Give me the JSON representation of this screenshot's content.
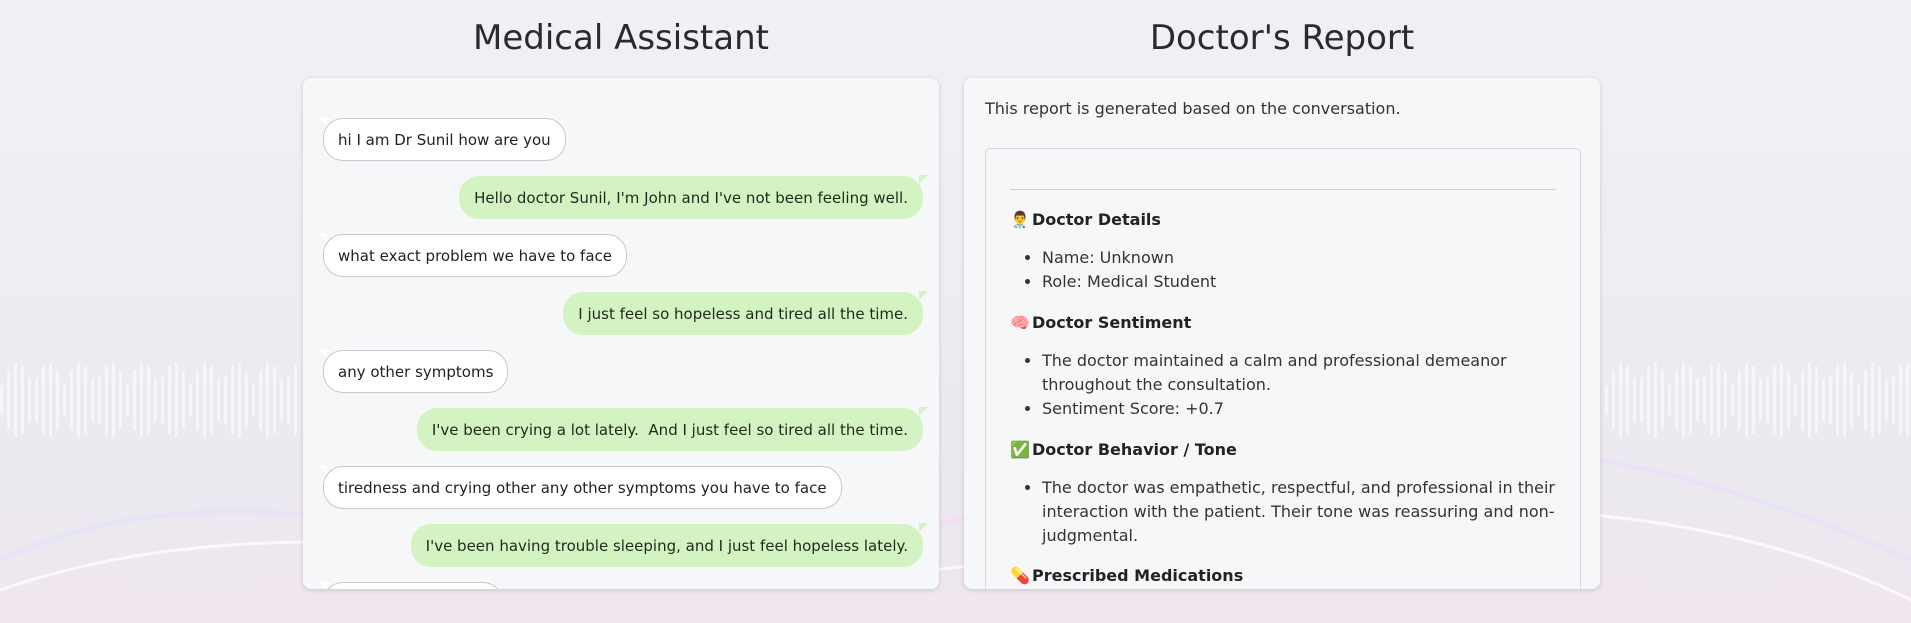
{
  "chat_title": "Medical Assistant",
  "report_title": "Doctor's Report",
  "messages": [
    {
      "role": "doctor",
      "text": "hi I am Dr Sunil how are you"
    },
    {
      "role": "patient",
      "text": "Hello doctor Sunil, I'm John and I've not been feeling well."
    },
    {
      "role": "doctor",
      "text": "what exact problem we have to face"
    },
    {
      "role": "patient",
      "text": "I just feel so hopeless and tired all the time."
    },
    {
      "role": "doctor",
      "text": "any other symptoms"
    },
    {
      "role": "patient",
      "text": "I've been crying a lot lately.  And I just feel so tired all the time."
    },
    {
      "role": "doctor",
      "text": "tiredness and crying other any other symptoms you have to face"
    },
    {
      "role": "patient",
      "text": "I've been having trouble sleeping, and I just feel hopeless lately."
    },
    {
      "role": "doctor",
      "text": ""
    }
  ],
  "report": {
    "intro": "This report is generated based on the conversation.",
    "sections": [
      {
        "icon": "doctor-icon",
        "emoji": "👨‍⚕️",
        "title": "Doctor Details",
        "items": [
          "Name: Unknown",
          "Role: Medical Student"
        ]
      },
      {
        "icon": "brain-icon",
        "emoji": "🧠",
        "title": "Doctor Sentiment",
        "items": [
          "The doctor maintained a calm and professional demeanor throughout the consultation.",
          "Sentiment Score: +0.7"
        ]
      },
      {
        "icon": "check-mark-icon",
        "emoji": "✅",
        "title": "Doctor Behavior / Tone",
        "items": [
          "The doctor was empathetic, respectful, and professional in their interaction with the patient. Their tone was reassuring and non-judgmental."
        ]
      },
      {
        "icon": "pill-icon",
        "emoji": "💊",
        "title": "Prescribed Medications",
        "items": []
      }
    ]
  },
  "colors": {
    "patient_bubble": "#d3f3c2",
    "doctor_bubble": "#ffffff",
    "panel": "#f6f7f9"
  }
}
